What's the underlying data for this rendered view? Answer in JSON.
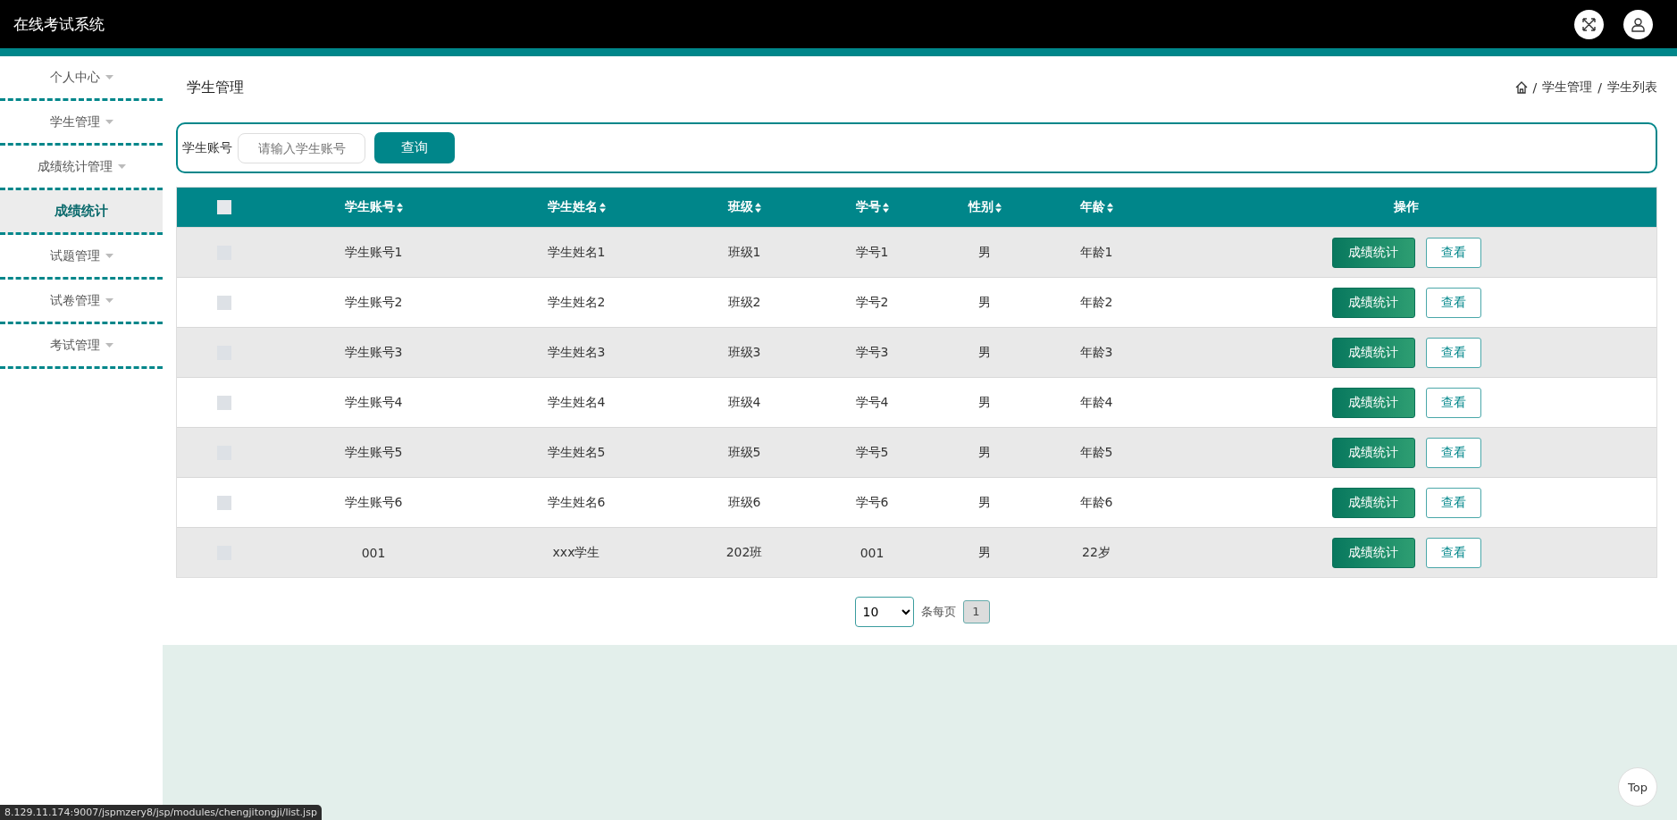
{
  "header": {
    "title": "在线考试系统"
  },
  "sidebar": {
    "items": [
      {
        "label": "个人中心",
        "selected": false
      },
      {
        "label": "学生管理",
        "selected": false
      },
      {
        "label": "成绩统计管理",
        "selected": false,
        "children": [
          {
            "label": "成绩统计",
            "selected": true
          }
        ]
      },
      {
        "label": "试题管理",
        "selected": false
      },
      {
        "label": "试卷管理",
        "selected": false
      },
      {
        "label": "考试管理",
        "selected": false
      }
    ]
  },
  "page_title": "学生管理",
  "breadcrumb": {
    "separator": "/",
    "items": [
      "学生管理",
      "学生列表"
    ]
  },
  "search": {
    "label": "学生账号",
    "placeholder": "请输入学生账号",
    "button": "查询"
  },
  "table": {
    "header_checked": false,
    "columns": [
      "学生账号",
      "学生姓名",
      "班级",
      "学号",
      "性别",
      "年龄",
      "操作"
    ],
    "rows": [
      {
        "checked": false,
        "cells": [
          "学生账号1",
          "学生姓名1",
          "班级1",
          "学号1",
          "男",
          "年龄1"
        ],
        "actions": [
          "成绩统计",
          "查看"
        ]
      },
      {
        "checked": false,
        "cells": [
          "学生账号2",
          "学生姓名2",
          "班级2",
          "学号2",
          "男",
          "年龄2"
        ],
        "actions": [
          "成绩统计",
          "查看"
        ]
      },
      {
        "checked": false,
        "cells": [
          "学生账号3",
          "学生姓名3",
          "班级3",
          "学号3",
          "男",
          "年龄3"
        ],
        "actions": [
          "成绩统计",
          "查看"
        ]
      },
      {
        "checked": false,
        "cells": [
          "学生账号4",
          "学生姓名4",
          "班级4",
          "学号4",
          "男",
          "年龄4"
        ],
        "actions": [
          "成绩统计",
          "查看"
        ]
      },
      {
        "checked": false,
        "cells": [
          "学生账号5",
          "学生姓名5",
          "班级5",
          "学号5",
          "男",
          "年龄5"
        ],
        "actions": [
          "成绩统计",
          "查看"
        ]
      },
      {
        "checked": false,
        "cells": [
          "学生账号6",
          "学生姓名6",
          "班级6",
          "学号6",
          "男",
          "年龄6"
        ],
        "actions": [
          "成绩统计",
          "查看"
        ]
      },
      {
        "checked": false,
        "cells": [
          "001",
          "xxx学生",
          "202班",
          "001",
          "男",
          "22岁"
        ],
        "actions": [
          "成绩统计",
          "查看"
        ]
      }
    ]
  },
  "pagination": {
    "page_size": "10",
    "page_size_label": "条每页",
    "pages": [
      {
        "label": "1",
        "selected": true
      }
    ]
  },
  "top_button": "Top",
  "status_url": "8.129.11.174:9007/jspmzery8/jsp/modules/chengjitongji/list.jsp"
}
